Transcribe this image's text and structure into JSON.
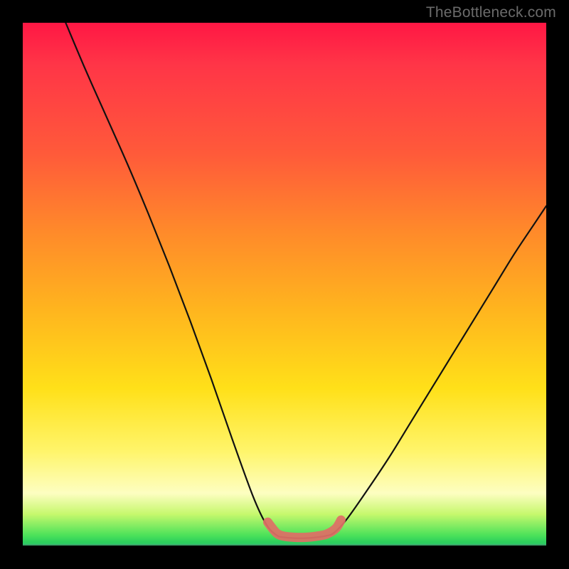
{
  "watermark": {
    "text": "TheBottleneck.com"
  },
  "colors": {
    "curve": "#111111",
    "highlight": "#df6f66",
    "background_stops": [
      "#ff1744",
      "#ff8a2a",
      "#ffe019",
      "#fdfec1",
      "#2dd05c"
    ]
  },
  "chart_data": {
    "type": "line",
    "title": "",
    "xlabel": "",
    "ylabel": "",
    "xlim": [
      0,
      100
    ],
    "ylim": [
      0,
      100
    ],
    "grid": false,
    "series": [
      {
        "name": "left-arm",
        "x": [
          8.2,
          12,
          16,
          20,
          24,
          28,
          32,
          36,
          40,
          44,
          46.5,
          48.5
        ],
        "y": [
          100,
          91,
          82,
          73,
          63.5,
          53.5,
          43,
          32,
          20.5,
          9.5,
          4.2,
          2.1
        ]
      },
      {
        "name": "valley-floor",
        "x": [
          48.5,
          50,
          52,
          54,
          56,
          58,
          59.5
        ],
        "y": [
          2.1,
          1.7,
          1.55,
          1.55,
          1.7,
          2.0,
          2.6
        ]
      },
      {
        "name": "right-arm",
        "x": [
          59.5,
          62,
          66,
          70,
          74,
          78,
          82,
          86,
          90,
          94,
          98,
          100
        ],
        "y": [
          2.6,
          5.3,
          11,
          17,
          23.5,
          30,
          36.5,
          43,
          49.5,
          56,
          62,
          65
        ]
      }
    ],
    "highlight": {
      "name": "valley-highlight",
      "x": [
        46.8,
        48.5,
        50,
        52,
        54,
        56,
        58,
        59.8,
        60.8
      ],
      "y": [
        4.6,
        2.5,
        1.9,
        1.7,
        1.7,
        1.9,
        2.3,
        3.4,
        5.0
      ]
    },
    "gradient_note": "Background hue maps a qualitative scale from red (high) at top to green (low) at bottom."
  }
}
